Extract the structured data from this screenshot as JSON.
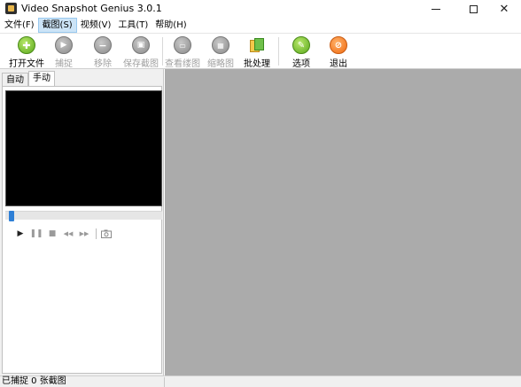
{
  "window": {
    "title": "Video Snapshot Genius 3.0.1",
    "controls": {
      "minimize": "—",
      "maximize": "☐",
      "close": "✕"
    }
  },
  "menu": [
    {
      "label": "文件(F)",
      "active": false
    },
    {
      "label": "截图(S)",
      "active": true
    },
    {
      "label": "视频(V)",
      "active": false
    },
    {
      "label": "工具(T)",
      "active": false
    },
    {
      "label": "帮助(H)",
      "active": false
    }
  ],
  "toolbar": {
    "open": {
      "label": "打开文件",
      "icon": "plus-icon",
      "enabled": true
    },
    "capture": {
      "label": "捕捉",
      "icon": "play-icon",
      "enabled": false
    },
    "remove": {
      "label": "移除",
      "icon": "minus-icon",
      "enabled": false
    },
    "save": {
      "label": "保存截图",
      "icon": "save-icon",
      "enabled": false
    },
    "view": {
      "label": "查看缕图",
      "icon": "view-icon",
      "enabled": false
    },
    "thumbs": {
      "label": "缩略图",
      "icon": "thumbnails-icon",
      "enabled": false
    },
    "batch": {
      "label": "批处理",
      "icon": "batch-icon",
      "enabled": true
    },
    "options": {
      "label": "选项",
      "icon": "wrench-icon",
      "enabled": true
    },
    "exit": {
      "label": "退出",
      "icon": "exit-icon",
      "enabled": true
    }
  },
  "tabs": [
    {
      "label": "自动",
      "selected": false
    },
    {
      "label": "手动",
      "selected": true
    }
  ],
  "player": {
    "seek_progress": 0,
    "controls": {
      "play": "▶",
      "pause": "❚❚",
      "stop": "■",
      "rewind": "◀◀",
      "forward": "▶▶",
      "snapshot": "📷"
    }
  },
  "status": {
    "text": "已捕捉 0 张截图"
  },
  "colors": {
    "canvas_bg": "#ababab",
    "menu_active": "#cce4f7",
    "seek_thumb": "#2e7fd6",
    "video_bg": "#000000"
  }
}
